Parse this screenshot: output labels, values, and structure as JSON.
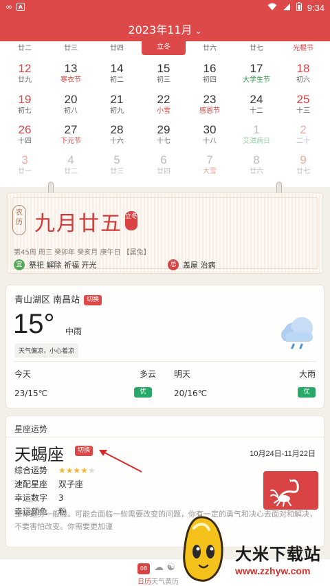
{
  "status_bar": {
    "time": "9:34"
  },
  "header": {
    "month_title": "2023年11月"
  },
  "calendar": {
    "today_label": "立冬",
    "rows": [
      [
        {
          "num": "",
          "sub": "廿二",
          "cls": ""
        },
        {
          "num": "",
          "sub": "廿三",
          "cls": ""
        },
        {
          "num": "",
          "sub": "廿四",
          "cls": ""
        },
        {
          "num": "",
          "sub": "",
          "cls": ""
        },
        {
          "num": "",
          "sub": "廿六",
          "cls": ""
        },
        {
          "num": "",
          "sub": "廿七",
          "cls": ""
        },
        {
          "num": "",
          "sub": "光棍节",
          "cls": "weekend red-sub"
        }
      ],
      [
        {
          "num": "12",
          "sub": "廿九",
          "cls": "weekend"
        },
        {
          "num": "13",
          "sub": "寒衣节",
          "cls": "red-sub"
        },
        {
          "num": "14",
          "sub": "初二",
          "cls": ""
        },
        {
          "num": "15",
          "sub": "初三",
          "cls": ""
        },
        {
          "num": "16",
          "sub": "初四",
          "cls": ""
        },
        {
          "num": "17",
          "sub": "大学生节",
          "cls": "green-sub"
        },
        {
          "num": "18",
          "sub": "初六",
          "cls": "weekend"
        }
      ],
      [
        {
          "num": "19",
          "sub": "初七",
          "cls": "weekend"
        },
        {
          "num": "20",
          "sub": "初八",
          "cls": ""
        },
        {
          "num": "21",
          "sub": "初九",
          "cls": ""
        },
        {
          "num": "22",
          "sub": "小雪",
          "cls": "red-sub"
        },
        {
          "num": "23",
          "sub": "感恩节",
          "cls": "red-sub"
        },
        {
          "num": "24",
          "sub": "十二",
          "cls": ""
        },
        {
          "num": "25",
          "sub": "十三",
          "cls": "weekend"
        }
      ],
      [
        {
          "num": "26",
          "sub": "十四",
          "cls": "weekend"
        },
        {
          "num": "27",
          "sub": "下元节",
          "cls": "red-sub"
        },
        {
          "num": "28",
          "sub": "十六",
          "cls": ""
        },
        {
          "num": "29",
          "sub": "十七",
          "cls": ""
        },
        {
          "num": "30",
          "sub": "十八",
          "cls": ""
        },
        {
          "num": "1",
          "sub": "艾滋病日",
          "cls": "next green-sub"
        },
        {
          "num": "2",
          "sub": "二十",
          "cls": "next weekend"
        }
      ],
      [
        {
          "num": "3",
          "sub": "廿一",
          "cls": "next weekend"
        },
        {
          "num": "4",
          "sub": "廿二",
          "cls": "next"
        },
        {
          "num": "5",
          "sub": "廿三",
          "cls": "next"
        },
        {
          "num": "6",
          "sub": "廿四",
          "cls": "next"
        },
        {
          "num": "7",
          "sub": "大雪",
          "cls": "next red-sub"
        },
        {
          "num": "8",
          "sub": "廿六",
          "cls": "next"
        },
        {
          "num": "9",
          "sub": "廿七",
          "cls": "next weekend"
        }
      ]
    ]
  },
  "almanac": {
    "stamp": "农历",
    "lunar_date": "九月廿五",
    "term_seal": "立冬",
    "ganzhi_line": "第45周 周三 癸卯年 癸亥月 庚午日 【属兔】",
    "yi_badge": "宜",
    "yi_text": "祭祀 解除 祈福 开光",
    "ji_badge": "忌",
    "ji_text": "盖屋 治病"
  },
  "weather": {
    "location": "青山湖区 南昌站",
    "switch_label": "切换",
    "temperature": "15°",
    "condition": "中雨",
    "tip": "天气偏凉，小心着凉",
    "today_label": "今天",
    "today_cond": "多云",
    "today_range": "23/15℃",
    "today_aq": "优",
    "tomorrow_label": "明天",
    "tomorrow_cond": "大雨",
    "tomorrow_range": "20/16℃",
    "tomorrow_aq": "优"
  },
  "zodiac": {
    "section_title": "星座运势",
    "name": "天蝎座",
    "switch_label": "切换",
    "date_range": "10月24日-11月22日",
    "overall_label": "综合运势",
    "overall_stars": 4,
    "match_label": "速配星座",
    "match_value": "双子座",
    "lucky_num_label": "幸运数字",
    "lucky_num_value": "3",
    "lucky_color_label": "幸运颜色",
    "lucky_color_value": "粉",
    "description": "整体运势一般般。可能会面临一些需要改变的问题，你有一定的勇气和决心去面对和解决，不要害怕改变。你需要更加谨"
  },
  "bottom_nav": {
    "calendar_day": "08",
    "label_active": "日历",
    "label_rest": "天气黄历"
  },
  "watermark": {
    "title": "大米下载站",
    "url": "www.zzhyw.com"
  },
  "colors": {
    "brand_red": "#dd4848",
    "good_green": "#2aa86a",
    "star_gold": "#f2b632"
  }
}
